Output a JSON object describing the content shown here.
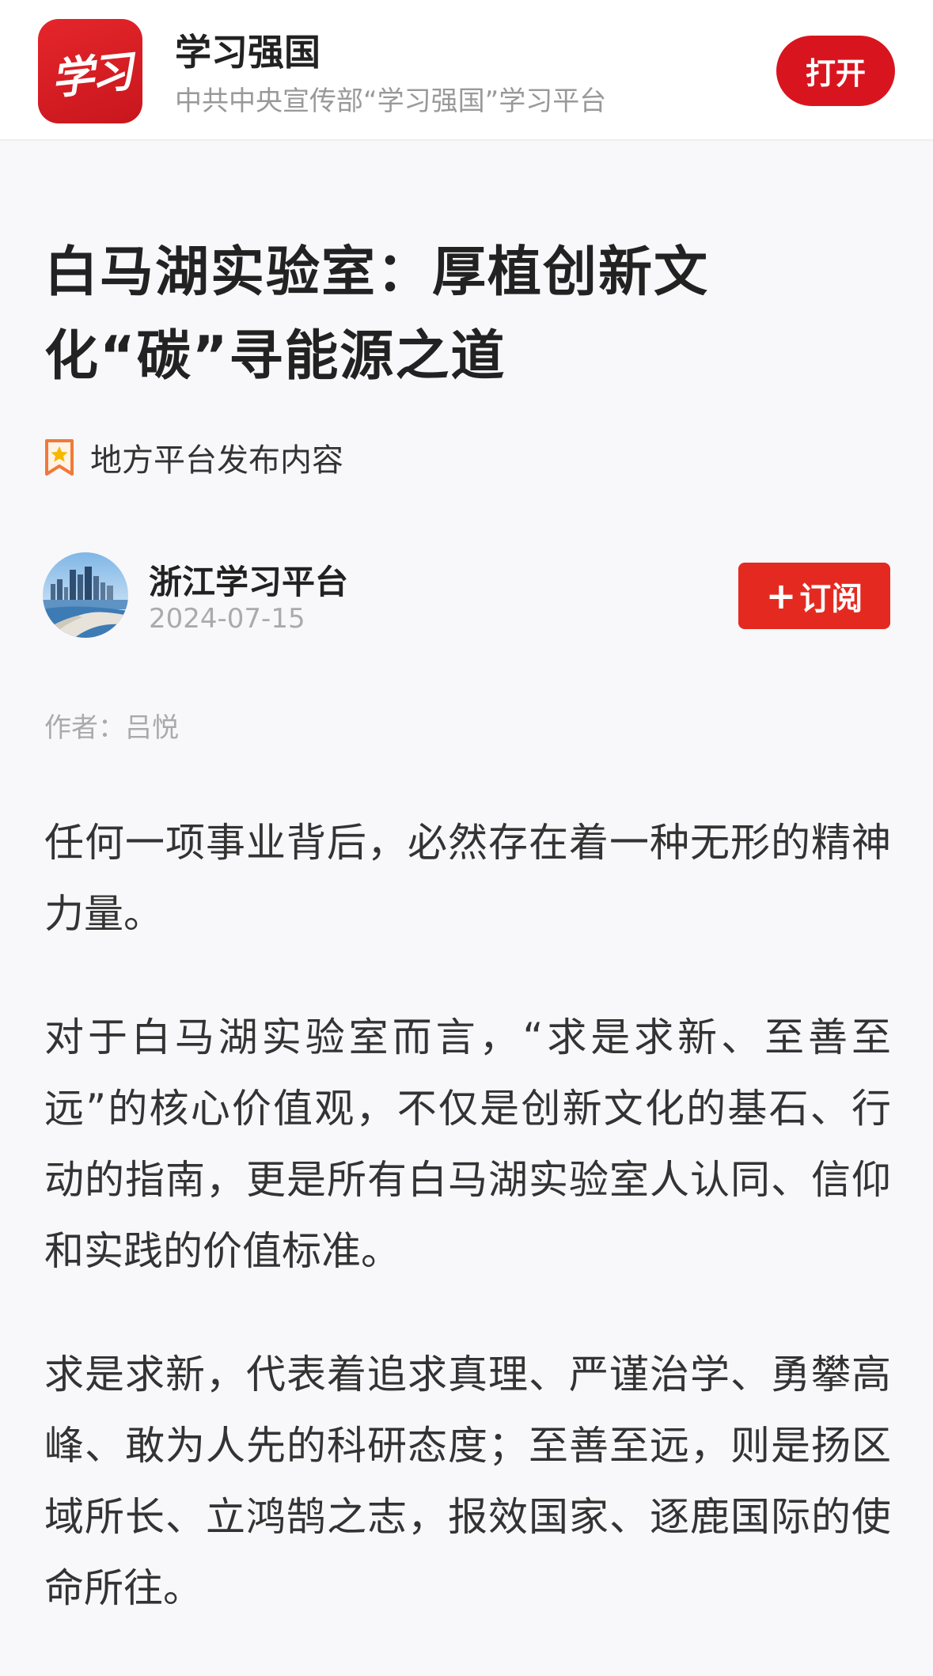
{
  "app_banner": {
    "logo_text": "学习",
    "app_name": "学习强国",
    "slogan": "中共中央宣传部“学习强国”学习平台",
    "open_label": "打开"
  },
  "article": {
    "title": "白马湖实验室：厚植创新文化“碳”寻能源之道",
    "source_label": "地方平台发布内容",
    "publisher": "浙江学习平台",
    "date": "2024-07-15",
    "subscribe_label": "订阅",
    "author": "作者：吕悦",
    "paragraphs": [
      "任何一项事业背后，必然存在着一种无形的精神力量。",
      "对于白马湖实验室而言，“求是求新、至善至远”的核心价值观，不仅是创新文化的基石、行动的指南，更是所有白马湖实验室人认同、信仰和实践的价值标准。",
      "求是求新，代表着追求真理、严谨治学、勇攀高峰、敢为人先的科研态度；至善至远，则是扬区域所长、立鸿鹄之志，报效国家、逐鹿国际的使命所往。"
    ]
  },
  "colors": {
    "brand_red": "#d8151f",
    "subscribe_red": "#e42a20",
    "background": "#f8f8fa"
  },
  "icons": {
    "source": "star-bookmark-icon",
    "avatar": "city-skyline-avatar"
  }
}
